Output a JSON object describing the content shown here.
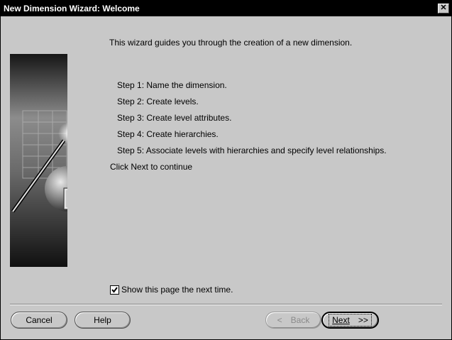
{
  "window": {
    "title": "New Dimension Wizard: Welcome"
  },
  "content": {
    "intro": "This wizard guides you through the creation of a new dimension.",
    "steps": [
      "Step 1: Name the dimension.",
      "Step 2: Create levels.",
      "Step 3: Create level attributes.",
      "Step 4: Create hierarchies.",
      "Step 5: Associate levels with hierarchies and specify level relationships."
    ],
    "continue_text": "Click Next to continue",
    "show_next_time": {
      "label": "Show this page the next time.",
      "checked": true
    }
  },
  "buttons": {
    "cancel": "Cancel",
    "help": "Help",
    "back": "Back",
    "next": "Next"
  },
  "icons": {
    "close": "close-icon",
    "back": "chevron-left-icon",
    "next": "chevron-right-icon",
    "wizard_art": "wizard-wand-illustration",
    "check": "checkmark-icon"
  }
}
